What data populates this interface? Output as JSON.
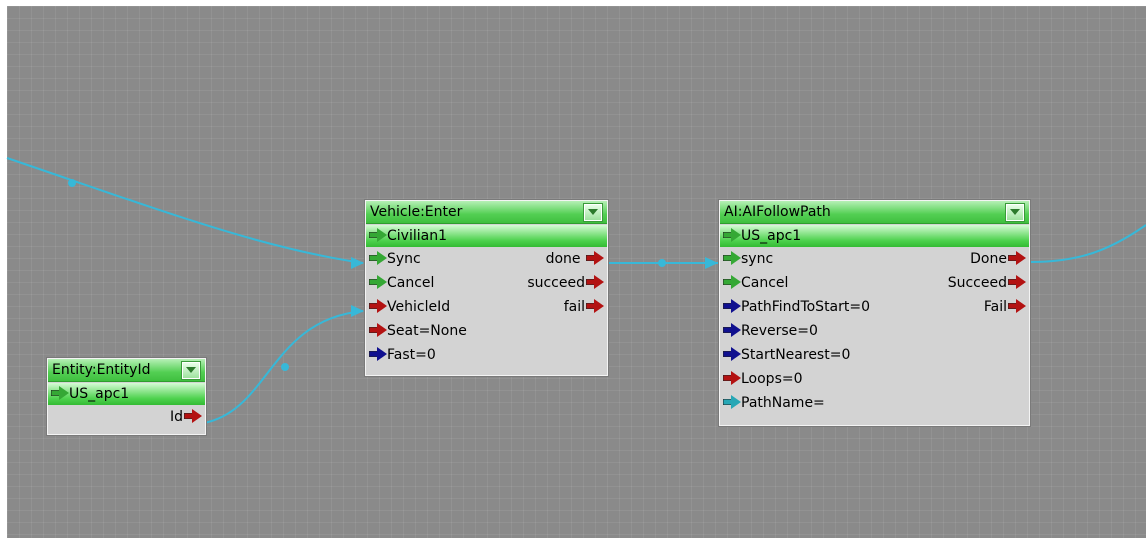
{
  "nodes": {
    "entity": {
      "title": "Entity:EntityId",
      "entity": "US_apc1",
      "ports": {
        "out_id": "Id"
      }
    },
    "vehicle": {
      "title": "Vehicle:Enter",
      "entity": "Civilian1",
      "inputs": [
        "Sync",
        "Cancel",
        "VehicleId",
        "Seat=None",
        "Fast=0"
      ],
      "outputs": [
        "done",
        "succeed",
        "fail"
      ]
    },
    "follow": {
      "title": "AI:AIFollowPath",
      "entity": "US_apc1",
      "inputs": [
        "sync",
        "Cancel",
        "PathFindToStart=0",
        "Reverse=0",
        "StartNearest=0",
        "Loops=0",
        "PathName="
      ],
      "outputs": [
        "Done",
        "Succeed",
        "Fail"
      ]
    }
  },
  "colors": {
    "background": "#8a8a8a",
    "edge": "#37b8d8",
    "port_trigger": "#35a835",
    "port_entity": "#b31212",
    "port_bool": "#10108f",
    "port_string": "#27a7b5",
    "header_green": "#53cf53"
  },
  "icons": {
    "dropdown": "chevron-down-icon",
    "port": "arrow-right-icon"
  }
}
